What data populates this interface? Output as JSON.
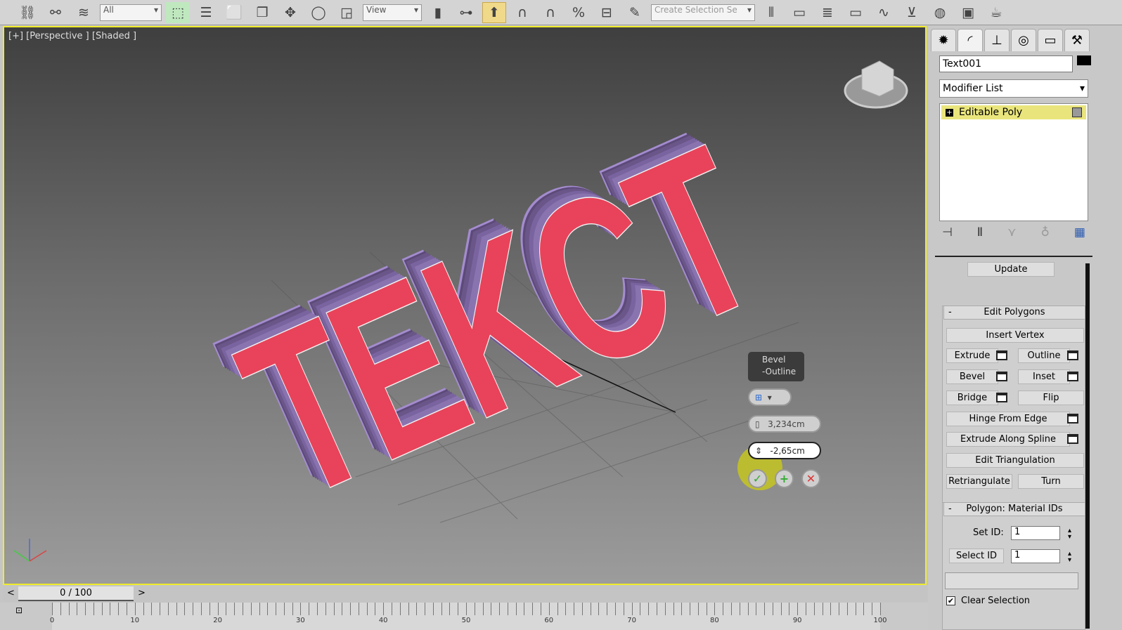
{
  "toolbar": {
    "selection_filter": "All",
    "reference_coord": "View",
    "named_selection": "Create Selection Se"
  },
  "viewport": {
    "label": "[+] [Perspective ] [Shaded ]",
    "scene_text": "TEKCT",
    "caddy": {
      "title_line1": "Bevel",
      "title_line2": "-Outline",
      "height_value": "3,234cm",
      "outline_value": "-2,65cm",
      "ok": "✓",
      "apply": "+",
      "cancel": "✕"
    }
  },
  "panel": {
    "object_name": "Text001",
    "modifier_list": "Modifier List",
    "stack_item": "Editable Poly",
    "update_button": "Update",
    "edit_polygons": {
      "title": "Edit Polygons",
      "collapse": "-",
      "insert_vertex": "Insert Vertex",
      "extrude": "Extrude",
      "outline": "Outline",
      "bevel": "Bevel",
      "inset": "Inset",
      "bridge": "Bridge",
      "flip": "Flip",
      "hinge": "Hinge From Edge",
      "extrude_spline": "Extrude Along Spline",
      "edit_tri": "Edit Triangulation",
      "retriangulate": "Retriangulate",
      "turn": "Turn"
    },
    "material_ids": {
      "title": "Polygon: Material IDs",
      "collapse": "-",
      "set_id_label": "Set ID:",
      "set_id_value": "1",
      "select_id": "Select ID",
      "select_id_value": "1",
      "clear_selection": "Clear Selection",
      "clear_checked": true
    }
  },
  "timeline": {
    "frame": "0 / 100",
    "prev": "<",
    "next": ">",
    "ticks": [
      "0",
      "10",
      "20",
      "30",
      "40",
      "50",
      "60",
      "70",
      "80",
      "90",
      "100"
    ]
  },
  "colors": {
    "viewport_border": "#f0ec2a",
    "face_red": "#e8435a",
    "side_purple": "#8a74b0",
    "top_purple": "#a48ccf",
    "stack_highlight": "#e9e57c"
  }
}
